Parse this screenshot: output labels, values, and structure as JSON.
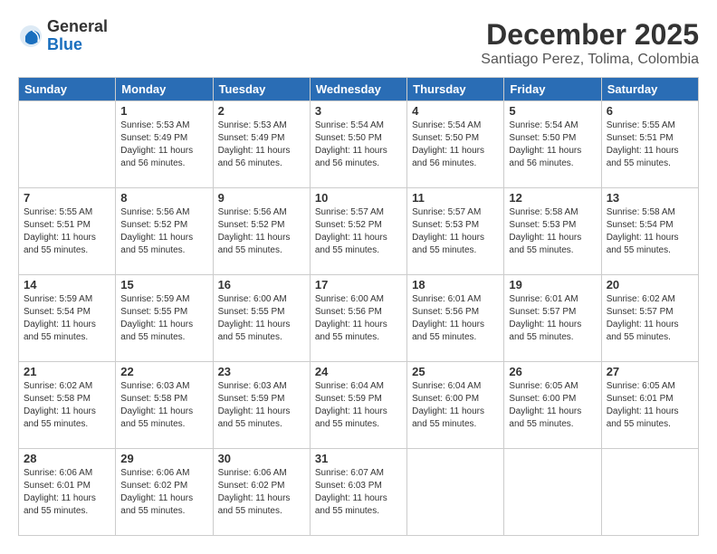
{
  "logo": {
    "general": "General",
    "blue": "Blue"
  },
  "title": "December 2025",
  "subtitle": "Santiago Perez, Tolima, Colombia",
  "headers": [
    "Sunday",
    "Monday",
    "Tuesday",
    "Wednesday",
    "Thursday",
    "Friday",
    "Saturday"
  ],
  "weeks": [
    [
      {
        "day": "",
        "info": ""
      },
      {
        "day": "1",
        "info": "Sunrise: 5:53 AM\nSunset: 5:49 PM\nDaylight: 11 hours\nand 56 minutes."
      },
      {
        "day": "2",
        "info": "Sunrise: 5:53 AM\nSunset: 5:49 PM\nDaylight: 11 hours\nand 56 minutes."
      },
      {
        "day": "3",
        "info": "Sunrise: 5:54 AM\nSunset: 5:50 PM\nDaylight: 11 hours\nand 56 minutes."
      },
      {
        "day": "4",
        "info": "Sunrise: 5:54 AM\nSunset: 5:50 PM\nDaylight: 11 hours\nand 56 minutes."
      },
      {
        "day": "5",
        "info": "Sunrise: 5:54 AM\nSunset: 5:50 PM\nDaylight: 11 hours\nand 56 minutes."
      },
      {
        "day": "6",
        "info": "Sunrise: 5:55 AM\nSunset: 5:51 PM\nDaylight: 11 hours\nand 55 minutes."
      }
    ],
    [
      {
        "day": "7",
        "info": "Sunrise: 5:55 AM\nSunset: 5:51 PM\nDaylight: 11 hours\nand 55 minutes."
      },
      {
        "day": "8",
        "info": "Sunrise: 5:56 AM\nSunset: 5:52 PM\nDaylight: 11 hours\nand 55 minutes."
      },
      {
        "day": "9",
        "info": "Sunrise: 5:56 AM\nSunset: 5:52 PM\nDaylight: 11 hours\nand 55 minutes."
      },
      {
        "day": "10",
        "info": "Sunrise: 5:57 AM\nSunset: 5:52 PM\nDaylight: 11 hours\nand 55 minutes."
      },
      {
        "day": "11",
        "info": "Sunrise: 5:57 AM\nSunset: 5:53 PM\nDaylight: 11 hours\nand 55 minutes."
      },
      {
        "day": "12",
        "info": "Sunrise: 5:58 AM\nSunset: 5:53 PM\nDaylight: 11 hours\nand 55 minutes."
      },
      {
        "day": "13",
        "info": "Sunrise: 5:58 AM\nSunset: 5:54 PM\nDaylight: 11 hours\nand 55 minutes."
      }
    ],
    [
      {
        "day": "14",
        "info": "Sunrise: 5:59 AM\nSunset: 5:54 PM\nDaylight: 11 hours\nand 55 minutes."
      },
      {
        "day": "15",
        "info": "Sunrise: 5:59 AM\nSunset: 5:55 PM\nDaylight: 11 hours\nand 55 minutes."
      },
      {
        "day": "16",
        "info": "Sunrise: 6:00 AM\nSunset: 5:55 PM\nDaylight: 11 hours\nand 55 minutes."
      },
      {
        "day": "17",
        "info": "Sunrise: 6:00 AM\nSunset: 5:56 PM\nDaylight: 11 hours\nand 55 minutes."
      },
      {
        "day": "18",
        "info": "Sunrise: 6:01 AM\nSunset: 5:56 PM\nDaylight: 11 hours\nand 55 minutes."
      },
      {
        "day": "19",
        "info": "Sunrise: 6:01 AM\nSunset: 5:57 PM\nDaylight: 11 hours\nand 55 minutes."
      },
      {
        "day": "20",
        "info": "Sunrise: 6:02 AM\nSunset: 5:57 PM\nDaylight: 11 hours\nand 55 minutes."
      }
    ],
    [
      {
        "day": "21",
        "info": "Sunrise: 6:02 AM\nSunset: 5:58 PM\nDaylight: 11 hours\nand 55 minutes."
      },
      {
        "day": "22",
        "info": "Sunrise: 6:03 AM\nSunset: 5:58 PM\nDaylight: 11 hours\nand 55 minutes."
      },
      {
        "day": "23",
        "info": "Sunrise: 6:03 AM\nSunset: 5:59 PM\nDaylight: 11 hours\nand 55 minutes."
      },
      {
        "day": "24",
        "info": "Sunrise: 6:04 AM\nSunset: 5:59 PM\nDaylight: 11 hours\nand 55 minutes."
      },
      {
        "day": "25",
        "info": "Sunrise: 6:04 AM\nSunset: 6:00 PM\nDaylight: 11 hours\nand 55 minutes."
      },
      {
        "day": "26",
        "info": "Sunrise: 6:05 AM\nSunset: 6:00 PM\nDaylight: 11 hours\nand 55 minutes."
      },
      {
        "day": "27",
        "info": "Sunrise: 6:05 AM\nSunset: 6:01 PM\nDaylight: 11 hours\nand 55 minutes."
      }
    ],
    [
      {
        "day": "28",
        "info": "Sunrise: 6:06 AM\nSunset: 6:01 PM\nDaylight: 11 hours\nand 55 minutes."
      },
      {
        "day": "29",
        "info": "Sunrise: 6:06 AM\nSunset: 6:02 PM\nDaylight: 11 hours\nand 55 minutes."
      },
      {
        "day": "30",
        "info": "Sunrise: 6:06 AM\nSunset: 6:02 PM\nDaylight: 11 hours\nand 55 minutes."
      },
      {
        "day": "31",
        "info": "Sunrise: 6:07 AM\nSunset: 6:03 PM\nDaylight: 11 hours\nand 55 minutes."
      },
      {
        "day": "",
        "info": ""
      },
      {
        "day": "",
        "info": ""
      },
      {
        "day": "",
        "info": ""
      }
    ]
  ]
}
